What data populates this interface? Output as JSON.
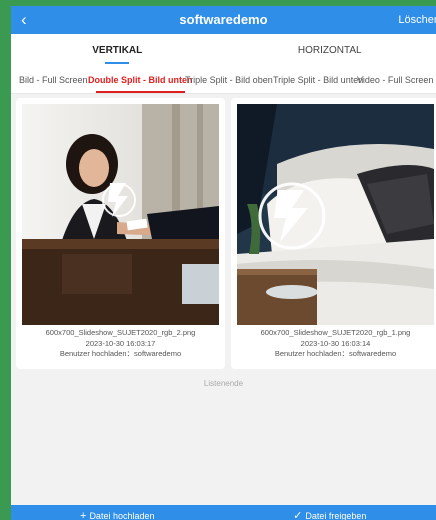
{
  "header": {
    "back_icon": "‹",
    "title": "softwaredemo",
    "delete_label": "Löschen"
  },
  "orientation_tabs": [
    {
      "label": "VERTIKAL",
      "active": true
    },
    {
      "label": "HORIZONTAL",
      "active": false
    }
  ],
  "layout_tabs": [
    {
      "label": "Bild - Full Screen",
      "active": false
    },
    {
      "label": "Double Split - Bild unten",
      "active": true
    },
    {
      "label": "Triple Split - Bild oben",
      "active": false
    },
    {
      "label": "Triple Split - Bild unten",
      "active": false
    },
    {
      "label": "Video - Full Screen unten",
      "active": false
    }
  ],
  "files": [
    {
      "image_icon": "lightning-bolt-icon",
      "filename": "600x700_Slideshow_SUJET2020_rgb_2.png",
      "date": "2023-10-30 16:03:17",
      "uploader": "Benutzer hochladen：softwaredemo"
    },
    {
      "image_icon": "lightning-bolt-icon",
      "filename": "600x700_Slideshow_SUJET2020_rgb_1.png",
      "date": "2023-10-30 16:03:14",
      "uploader": "Benutzer hochladen：softwaredemo"
    }
  ],
  "list_end": "Listenende",
  "footer": {
    "upload_icon": "+",
    "upload_label": "Datei hochladen",
    "share_icon": "✓",
    "share_label": "Datei freigeben"
  },
  "colors": {
    "accent": "#2f8ee8",
    "active_tab": "#e02020",
    "outer_border": "#3a9a52"
  }
}
